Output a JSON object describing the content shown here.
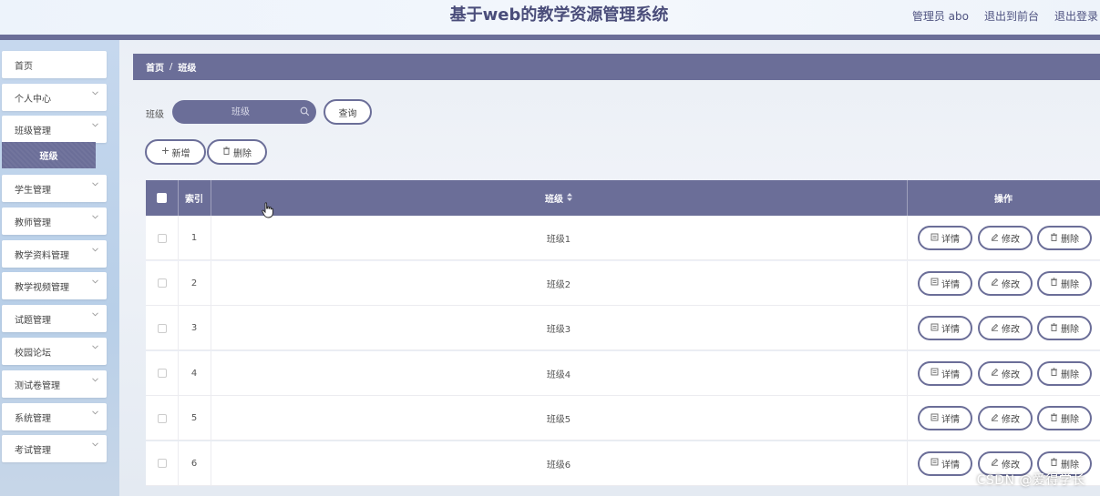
{
  "header": {
    "title": "基于web的教学资源管理系统",
    "user": "管理员 abo",
    "to_front": "退出到前台",
    "logout": "退出登录"
  },
  "sidebar": {
    "items": [
      {
        "label": "首页",
        "has_children": false
      },
      {
        "label": "个人中心",
        "has_children": true
      },
      {
        "label": "班级管理",
        "has_children": true
      },
      {
        "label": "学生管理",
        "has_children": true
      },
      {
        "label": "教师管理",
        "has_children": true
      },
      {
        "label": "教学资料管理",
        "has_children": true
      },
      {
        "label": "教学视频管理",
        "has_children": true
      },
      {
        "label": "试题管理",
        "has_children": true
      },
      {
        "label": "校园论坛",
        "has_children": true
      },
      {
        "label": "测试卷管理",
        "has_children": true
      },
      {
        "label": "系统管理",
        "has_children": true
      },
      {
        "label": "考试管理",
        "has_children": true
      }
    ],
    "active_sub": "班级"
  },
  "breadcrumb": {
    "home": "首页",
    "sep": "/",
    "current": "班级"
  },
  "search": {
    "label": "班级",
    "placeholder": "班级",
    "query_button": "查询"
  },
  "toolbar": {
    "add_label": "新增",
    "delete_label": "删除"
  },
  "table": {
    "headers": {
      "index": "索引",
      "name": "班级",
      "actions": "操作"
    },
    "rows": [
      {
        "index": "1",
        "name": "班级1"
      },
      {
        "index": "2",
        "name": "班级2"
      },
      {
        "index": "3",
        "name": "班级3"
      },
      {
        "index": "4",
        "name": "班级4"
      },
      {
        "index": "5",
        "name": "班级5"
      },
      {
        "index": "6",
        "name": "班级6"
      }
    ],
    "row_actions": {
      "detail": "详情",
      "edit": "修改",
      "delete": "删除"
    }
  },
  "watermark": "CSDN @爱得学长",
  "colors": {
    "primary": "#6b6e98",
    "sidebar_bg": "#c6d8ee",
    "header_text": "#4a4d7a"
  }
}
